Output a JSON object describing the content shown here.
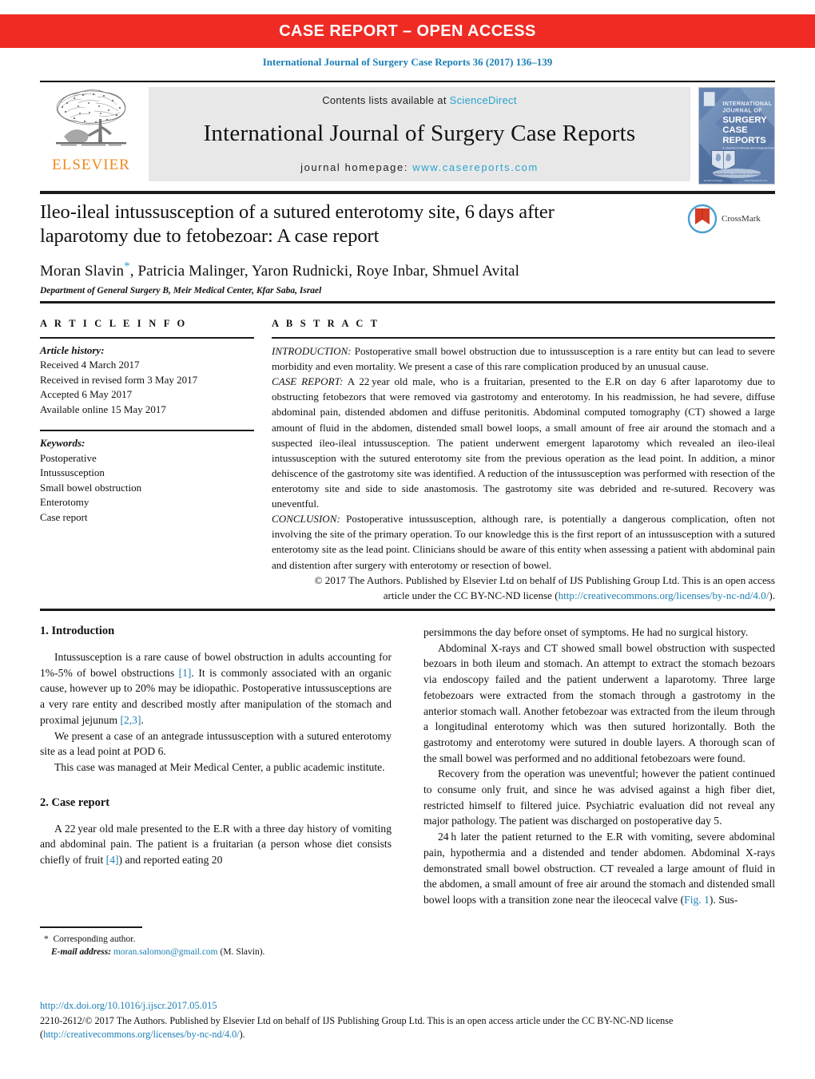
{
  "banner": {
    "text": "CASE REPORT – OPEN ACCESS",
    "background_color": "#ef2b24",
    "text_color": "#ffffff"
  },
  "running_head": "International Journal of Surgery Case Reports 36 (2017) 136–139",
  "masthead": {
    "publisher_logo_name": "elsevier-tree-logo",
    "publisher_wordmark": "ELSEVIER",
    "publisher_color": "#f08a1d",
    "contents_prefix": "Contents lists available at",
    "contents_link": "ScienceDirect",
    "journal_title": "International Journal of Surgery Case Reports",
    "homepage_prefix": "journal homepage:",
    "homepage_link": "www.casereports.com",
    "cover_lines": [
      "INTERNATIONAL",
      "JOURNAL OF",
      "SURGERY",
      "CASE",
      "REPORTS"
    ],
    "link_color": "#2aa3cd"
  },
  "article": {
    "title": "Ileo-ileal intussusception of a sutured enterotomy site, 6 days after laparotomy due to fetobezoar: A case report",
    "authors": "Moran Slavin, Patricia Malinger, Yaron Rudnicki, Roye Inbar, Shmuel Avital",
    "corresponding_marker": "*",
    "affiliation": "Department of General Surgery B, Meir Medical Center, Kfar Saba, Israel",
    "crossmark_label": "CrossMark"
  },
  "article_info": {
    "heading": "A R T I C L E   I N F O",
    "history_label": "Article history:",
    "history": [
      "Received 4 March 2017",
      "Received in revised form 3 May 2017",
      "Accepted 6 May 2017",
      "Available online 15 May 2017"
    ],
    "keywords_label": "Keywords:",
    "keywords": [
      "Postoperative",
      "Intussusception",
      "Small bowel obstruction",
      "Enterotomy",
      "Case report"
    ]
  },
  "abstract": {
    "heading": "A B S T R A C T",
    "introduction_label": "INTRODUCTION:",
    "introduction_text": " Postoperative small bowel obstruction due to intussusception is a rare entity but can lead to severe morbidity and even mortality. We present a case of this rare complication produced by an unusual cause.",
    "case_report_label": "CASE REPORT:",
    "case_report_text": " A 22 year old male, who is a fruitarian, presented to the E.R on day 6 after laparotomy due to obstructing fetobezors that were removed via gastrotomy and enterotomy. In his readmission, he had severe, diffuse abdominal pain, distended abdomen and diffuse peritonitis. Abdominal computed tomography (CT) showed a large amount of fluid in the abdomen, distended small bowel loops, a small amount of free air around the stomach and a suspected ileo-ileal intussusception. The patient underwent emergent laparotomy which revealed an ileo-ileal intussusception with the sutured enterotomy site from the previous operation as the lead point. In addition, a minor dehiscence of the gastrotomy site was identified. A reduction of the intussusception was performed with resection of the enterotomy site and side to side anastomosis. The gastrotomy site was debrided and re-sutured. Recovery was uneventful.",
    "conclusion_label": "CONCLUSION:",
    "conclusion_text": " Postoperative intussusception, although rare, is potentially a dangerous complication, often not involving the site of the primary operation. To our knowledge this is the first report of an intussusception with a sutured enterotomy site as the lead point. Clinicians should be aware of this entity when assessing a patient with abdominal pain and distention after surgery with enterotomy or resection of bowel.",
    "copyright_text": "© 2017 The Authors. Published by Elsevier Ltd on behalf of IJS Publishing Group Ltd. This is an open access article under the CC BY-NC-ND license (",
    "copyright_link": "http://creativecommons.org/licenses/by-nc-nd/4.0/",
    "copyright_suffix": ")."
  },
  "body": {
    "left": {
      "section1_heading": "1.  Introduction",
      "p1_a": "Intussusception is a rare cause of bowel obstruction in adults accounting for 1%-5% of bowel obstructions ",
      "p1_ref1": "[1]",
      "p1_b": ". It is commonly associated with an organic cause, however up to 20% may be idiopathic. Postoperative intussusceptions are a very rare entity and described mostly after manipulation of the stomach and proximal jejunum ",
      "p1_ref2": "[2,3]",
      "p1_c": ".",
      "p2": "We present a case of an antegrade intussusception with a sutured enterotomy site as a lead point at POD 6.",
      "p3": "This case was managed at Meir Medical Center, a public academic institute.",
      "section2_heading": "2.  Case report",
      "p4_a": "A 22 year old male presented to the E.R with a three day history of vomiting and abdominal pain. The patient is a fruitarian (a person whose diet consists chiefly of fruit ",
      "p4_ref": "[4]",
      "p4_b": ") and reported eating 20"
    },
    "right": {
      "p1": "persimmons the day before onset of symptoms. He had no surgical history.",
      "p2": "Abdominal X-rays and CT showed small bowel obstruction with suspected bezoars in both ileum and stomach. An attempt to extract the stomach bezoars via endoscopy failed and the patient underwent a laparotomy. Three large fetobezoars were extracted from the stomach through a gastrotomy in the anterior stomach wall. Another fetobezoar was extracted from the ileum through a longitudinal enterotomy which was then sutured horizontally. Both the gastrotomy and enterotomy were sutured in double layers. A thorough scan of the small bowel was performed and no additional fetobezoars were found.",
      "p3": "Recovery from the operation was uneventful; however the patient continued to consume only fruit, and since he was advised against a high fiber diet, restricted himself to filtered juice. Psychiatric evaluation did not reveal any major pathology. The patient was discharged on postoperative day 5.",
      "p4_a": "24 h later the patient returned to the E.R with vomiting, severe abdominal pain, hypothermia and a distended and tender abdomen. Abdominal X-rays demonstrated small bowel obstruction. CT revealed a large amount of fluid in the abdomen, a small amount of free air around the stomach and distended small bowel loops with a transition zone near the ileocecal valve (",
      "p4_ref": "Fig. 1",
      "p4_b": "). Sus-"
    }
  },
  "footnote": {
    "corresponding_marker": "*",
    "corresponding_text": "Corresponding author.",
    "email_label": "E-mail address:",
    "email": "moran.salomon@gmail.com",
    "email_owner": "(M. Slavin)."
  },
  "bottom": {
    "doi": "http://dx.doi.org/10.1016/j.ijscr.2017.05.015",
    "copyright_prefix": "2210-2612/© 2017 The Authors. Published by Elsevier Ltd on behalf of IJS Publishing Group Ltd. This is an open access article under the CC BY-NC-ND license (",
    "copyright_link": "http://creativecommons.org/licenses/by-nc-nd/4.0/",
    "copyright_suffix": ")."
  }
}
